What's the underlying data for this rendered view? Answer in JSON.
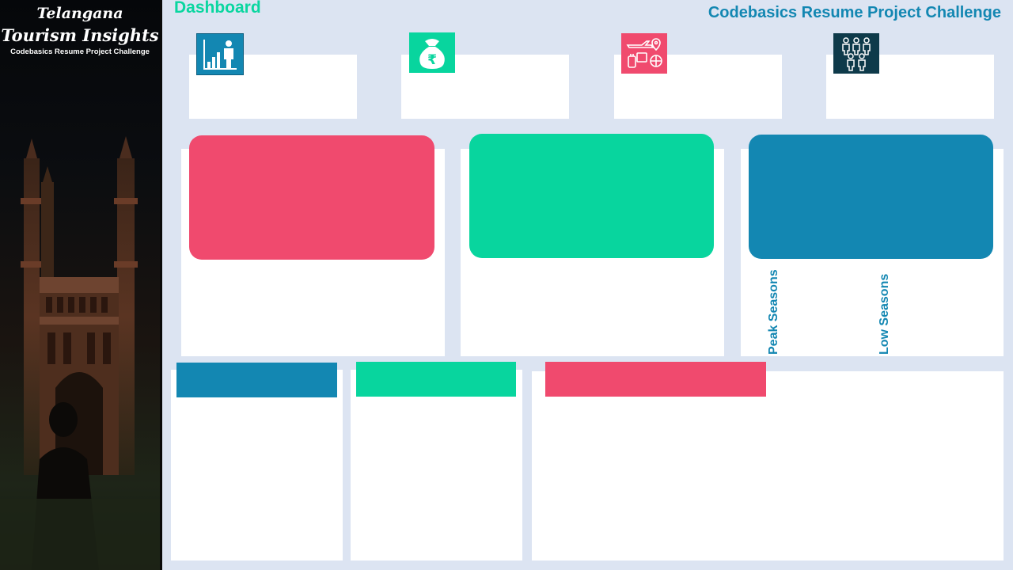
{
  "sidebar": {
    "title_line1": "Telangana",
    "title_line2": "Tourism Insights",
    "subtitle": "Codebasics Resume Project Challenge"
  },
  "header": {
    "dashboard_label": "Dashboard",
    "challenge_label": "Codebasics Resume Project Challenge"
  },
  "kpis": [
    {
      "icon": "visitor-growth-icon",
      "color": "#1387b2"
    },
    {
      "icon": "rupee-money-bag-icon",
      "color": "#08d59e"
    },
    {
      "icon": "travel-icon",
      "color": "#f04a6e"
    },
    {
      "icon": "people-group-icon",
      "color": "#0e3a4a"
    }
  ],
  "seasons": {
    "peak_label": "Peak Seasons",
    "low_label": "Low Seasons"
  },
  "colors": {
    "pink": "#f04a6e",
    "green": "#08d59e",
    "blue": "#1387b2",
    "background": "#dce4f2"
  }
}
